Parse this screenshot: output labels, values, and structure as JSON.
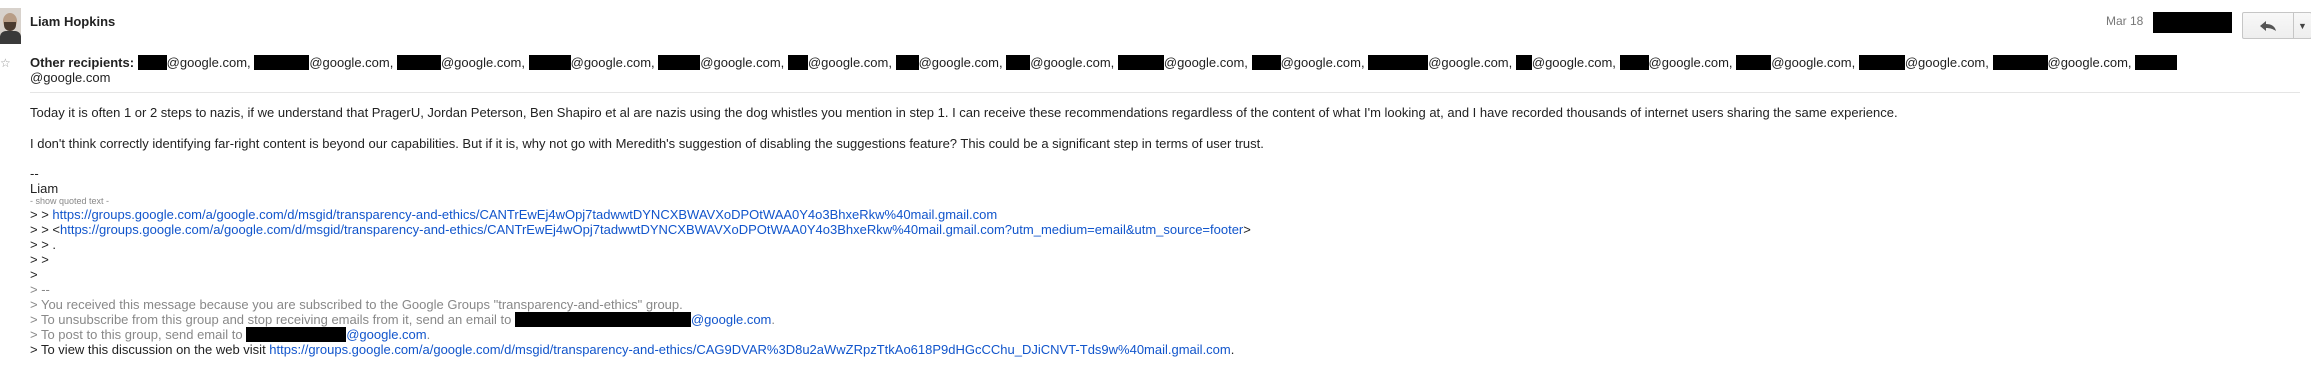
{
  "message": {
    "sender": "Liam Hopkins",
    "date": "Mar 18",
    "reply_icon": "reply-icon",
    "more_icon": "chevron-down-icon",
    "recipients_label": "Other recipients:",
    "recipient_domain": "@google.com,",
    "recipient_domain_last": "@google.com",
    "body": {
      "p1": "Today it is often 1 or 2 steps to nazis, if we understand that PragerU, Jordan Peterson, Ben Shapiro et al are nazis using the dog whistles you mention in step 1. I can receive these recommendations regardless of the content of what I'm looking at, and I have recorded thousands of internet users sharing the same experience.",
      "p2": "I don't think correctly identifying far-right content is beyond our capabilities. But if it is, why not go with Meredith's suggestion of disabling the suggestions feature? This could be a significant step in terms of user trust.",
      "sig_dash": "--",
      "sig_name": "Liam",
      "show_quoted": "- show quoted text -"
    },
    "quoted": {
      "l1_prefix": "> > ",
      "l1_link": "https://groups.google.com/a/google.com/d/msgid/transparency-and-ethics/CANTrEwEj4wOpj7tadwwtDYNCXBWAVXoDPOtWAA0Y4o3BhxeRkw%40mail.gmail.com",
      "l2_prefix": "> > <",
      "l2_link": "https://groups.google.com/a/google.com/d/msgid/transparency-and-ethics/CANTrEwEj4wOpj7tadwwtDYNCXBWAVXoDPOtWAA0Y4o3BhxeRkw%40mail.gmail.com?utm_medium=email&utm_source=footer",
      "l2_suffix": ">",
      "l3": "> > .",
      "l4": "> >",
      "l5": ">",
      "l6": "> --",
      "l7": "> You received this message because you are subscribed to the Google Groups \"transparency-and-ethics\" group.",
      "l8_prefix": "> To unsubscribe from this group and stop receiving emails from it, send an email to ",
      "l8_domain": "@google.com",
      "l8_suffix": ".",
      "l9_prefix": "> To post to this group, send email to ",
      "l9_domain": "@google.com",
      "l9_suffix": ".",
      "l10_prefix": "> To view this discussion on the web visit ",
      "l10_link": "https://groups.google.com/a/google.com/d/msgid/transparency-and-ethics/CAG9DVAR%3D8u2aWwZRpzTtkAo618P9dHGcCChu_DJiCNVT-Tds9w%40mail.gmail.com",
      "l10_suffix": "."
    }
  }
}
